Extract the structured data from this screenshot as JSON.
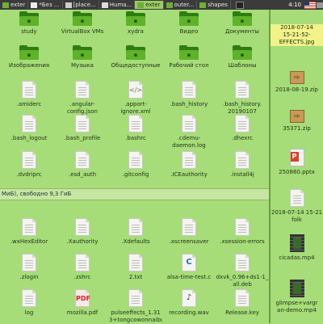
{
  "taskbar": {
    "tasks": [
      "exter",
      "*Без ...",
      "[place...",
      "Huma...",
      "exter",
      "outer...",
      "shapes"
    ],
    "clock": "4:10"
  },
  "file_manager": {
    "rows": [
      [
        {
          "name": "study",
          "type": "folder"
        },
        {
          "name": "VirtualBox VMs",
          "type": "folder"
        },
        {
          "name": "xydra",
          "type": "folder"
        },
        {
          "name": "Видео",
          "type": "folder"
        },
        {
          "name": "Документы",
          "type": "folder"
        }
      ],
      [
        {
          "name": "Изображения",
          "type": "folder"
        },
        {
          "name": "Музыка",
          "type": "folder"
        },
        {
          "name": "Общедоступные",
          "type": "folder"
        },
        {
          "name": "Рабочий стол",
          "type": "folder"
        },
        {
          "name": "Шаблоны",
          "type": "folder"
        }
      ],
      [
        {
          "name": ".amiderc",
          "type": "doc"
        },
        {
          "name": ".angular-",
          "name2": "config.json",
          "type": "doc"
        },
        {
          "name": ".apport-",
          "name2": "ignore.xml",
          "type": "doc",
          "glyph": "</>"
        },
        {
          "name": ".bash_history",
          "type": "doc"
        },
        {
          "name": ".bash_history.",
          "name2": "20190107",
          "type": "doc"
        }
      ],
      [
        {
          "name": ".bash_logout",
          "type": "doc"
        },
        {
          "name": ".bash_profile",
          "type": "doc"
        },
        {
          "name": ".bashrc",
          "type": "doc"
        },
        {
          "name": ".cdemu-",
          "name2": "daemon.log",
          "type": "doc"
        },
        {
          "name": ".dhexrc",
          "type": "doc"
        }
      ],
      [
        {
          "name": ".dvdriprc",
          "type": "doc"
        },
        {
          "name": ".esd_auth",
          "type": "doc"
        },
        {
          "name": ".gitconfig",
          "type": "doc"
        },
        {
          "name": ".ICEauthority",
          "type": "doc"
        },
        {
          "name": ".install4j",
          "type": "doc"
        }
      ],
      [
        {
          "name": ".wxHexEditor",
          "type": "doc"
        },
        {
          "name": ".Xauthority",
          "type": "doc"
        },
        {
          "name": ".Xdefaults",
          "type": "doc"
        },
        {
          "name": ".xscreensaver",
          "type": "doc"
        },
        {
          "name": ".xsession-errors",
          "type": "doc"
        }
      ],
      [
        {
          "name": ".zlogin",
          "type": "doc"
        },
        {
          "name": ".zshrc",
          "type": "doc"
        },
        {
          "name": "2.txt",
          "type": "doc"
        },
        {
          "name": "alsa-time-test.c",
          "type": "doc",
          "glyph": "C"
        },
        {
          "name": "dxvk_0.96+ds1-1_",
          "name2": "all.deb",
          "type": "doc"
        }
      ],
      [
        {
          "name": "log",
          "type": "doc"
        },
        {
          "name": "mozilla.pdf",
          "type": "doc",
          "glyph": "PDF"
        },
        {
          "name": "pulseeffects_1.31",
          "name2": "3+tongcowonnaibu",
          "type": "doc"
        },
        {
          "name": "recording.wav",
          "type": "doc",
          "glyph": "♪"
        },
        {
          "name": "Release.key",
          "type": "doc"
        }
      ]
    ],
    "status": "МиБ), свободно 9,3 ГиБ"
  },
  "desktop": {
    "items": [
      {
        "name": "2018-07-14",
        "name2": "15-21-52-",
        "name3": "EFFECTS.jpg",
        "type": "image",
        "selected": true
      },
      {
        "name": "2018-08-19.zip",
        "type": "zip"
      },
      {
        "name": "35371.zip",
        "type": "zip"
      },
      {
        "name": "250860.pptx",
        "type": "ppt"
      },
      {
        "name": "2018-07-14 15-21",
        "name2": "folk",
        "type": "doc"
      },
      {
        "name": "cicadas.mp4",
        "type": "video"
      },
      {
        "name": "glimpse+vargr",
        "name2": "an-demo.mp4",
        "type": "video"
      }
    ]
  }
}
